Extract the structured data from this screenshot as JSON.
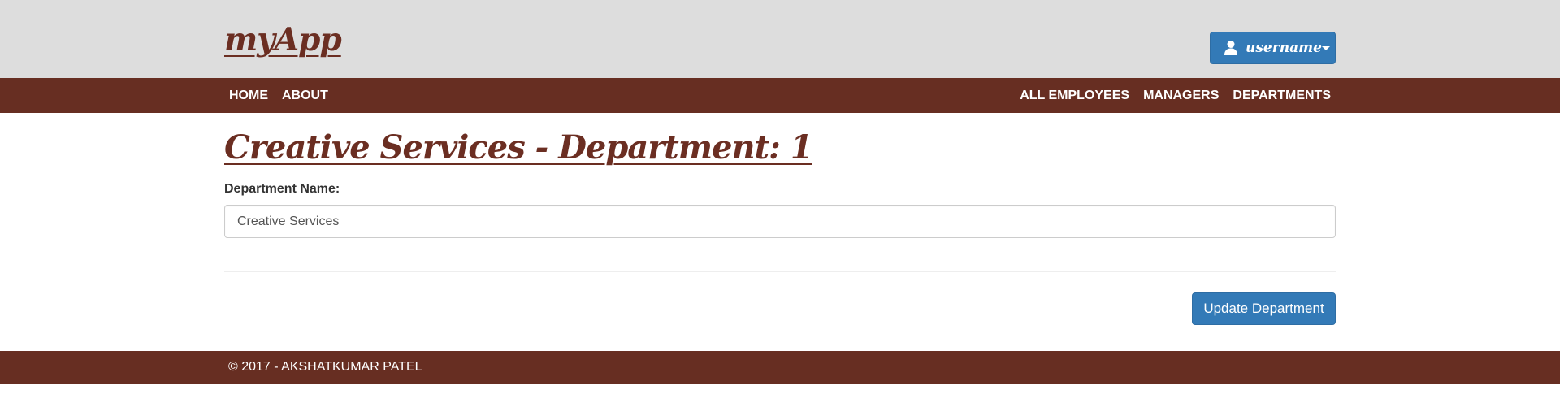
{
  "header": {
    "logo": "myApp",
    "user_label": "username",
    "icon": "user-icon"
  },
  "nav": {
    "left": [
      "HOME",
      "ABOUT"
    ],
    "right": [
      "ALL EMPLOYEES",
      "MANAGERS",
      "DEPARTMENTS"
    ]
  },
  "main": {
    "title": "Creative Services - Department: 1",
    "field_label": "Department Name:",
    "field_value": "Creative Services",
    "submit_label": "Update Department"
  },
  "footer": {
    "text": "© 2017 - AKSHATKUMAR PATEL"
  },
  "colors": {
    "brand": "#672e22",
    "header_bg": "#dddddd",
    "primary_button": "#337ab7"
  }
}
